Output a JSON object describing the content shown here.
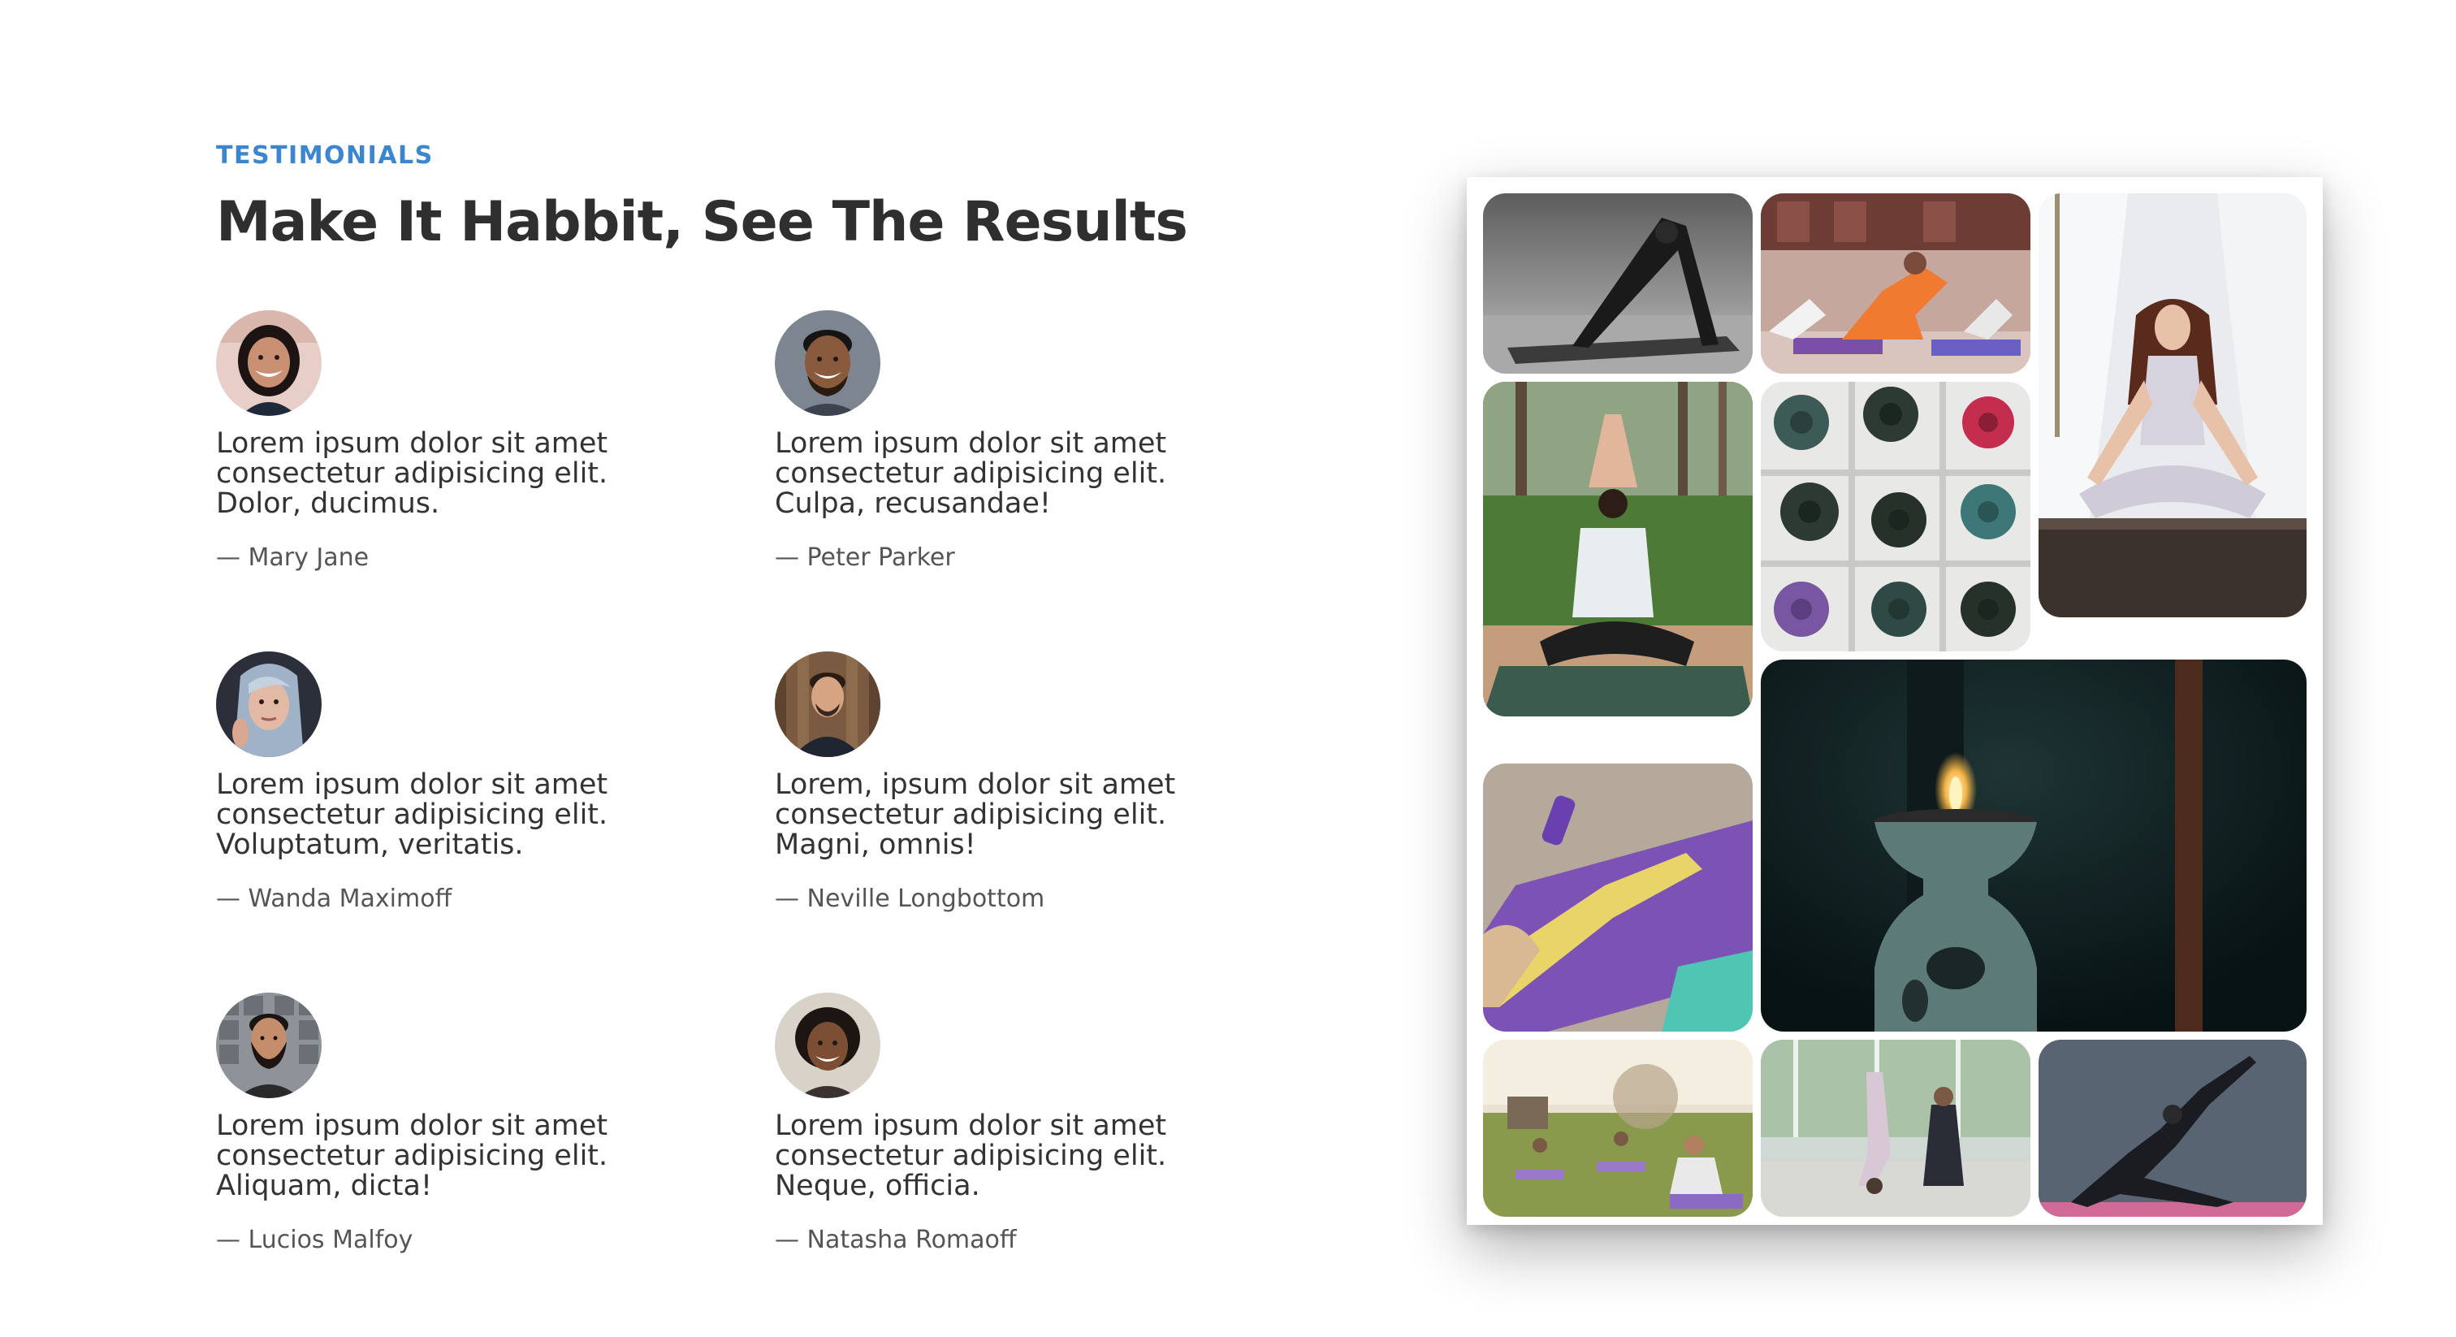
{
  "section": {
    "kicker": "TESTIMONIALS",
    "title": "Make It Habbit, See The Results"
  },
  "testimonials": [
    {
      "quote_line1": "Lorem ipsum dolor sit amet",
      "quote_line2": "consectetur adipisicing elit.",
      "quote_line3": "Dolor, ducimus.",
      "author": "— Mary Jane"
    },
    {
      "quote_line1": "Lorem ipsum dolor sit amet",
      "quote_line2": "consectetur adipisicing elit.",
      "quote_line3": "Culpa, recusandae!",
      "author": "— Peter Parker"
    },
    {
      "quote_line1": "Lorem ipsum dolor sit amet",
      "quote_line2": "consectetur adipisicing elit.",
      "quote_line3": "Voluptatum, veritatis.",
      "author": "— Wanda Maximoff"
    },
    {
      "quote_line1": "Lorem, ipsum dolor sit amet",
      "quote_line2": "consectetur adipisicing elit.",
      "quote_line3": "Magni, omnis!",
      "author": "— Neville Longbottom"
    },
    {
      "quote_line1": "Lorem ipsum dolor sit amet",
      "quote_line2": "consectetur adipisicing elit.",
      "quote_line3": "Aliquam, dicta!",
      "author": "— Lucios Malfoy"
    },
    {
      "quote_line1": "Lorem ipsum dolor sit amet",
      "quote_line2": "consectetur adipisicing elit.",
      "quote_line3": "Neque, officia.",
      "author": "— Natasha Romaoff"
    }
  ],
  "colors": {
    "accent": "#3a86d0",
    "heading": "#2f2f2f",
    "body_text": "#333333",
    "author_text": "#555555"
  },
  "gallery": {
    "photos": [
      "yoga-downward-dog-photo",
      "yoga-class-stretch-photo",
      "meditation-lotus-photo",
      "outdoor-yoga-pose-photo",
      "yoga-mats-shelf-photo",
      "candle-oil-burner-photo",
      "stretching-on-mat-photo",
      "outdoor-group-yoga-photo",
      "partner-yoga-photo",
      "lunge-stretch-photo"
    ]
  }
}
